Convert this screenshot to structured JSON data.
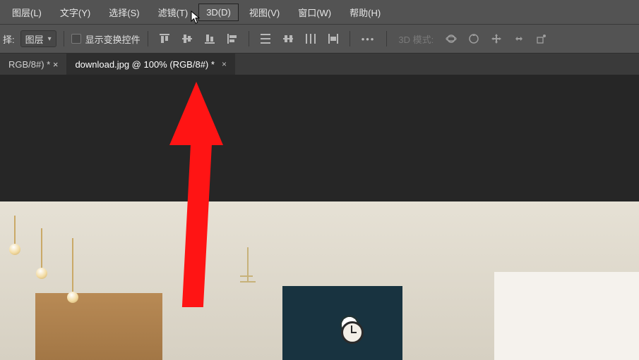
{
  "menubar": {
    "items": [
      {
        "label": "图层(L)"
      },
      {
        "label": "文字(Y)"
      },
      {
        "label": "选择(S)"
      },
      {
        "label": "滤镜(T)"
      },
      {
        "label": "3D(D)",
        "highlight": true
      },
      {
        "label": "视图(V)"
      },
      {
        "label": "窗口(W)"
      },
      {
        "label": "帮助(H)"
      }
    ]
  },
  "options": {
    "leading_label": "择:",
    "target_value": "图层",
    "show_transform_label": "显示变换控件",
    "mode_label": "3D 模式:"
  },
  "tabs": [
    {
      "label": "RGB/8#) * ×",
      "active": false
    },
    {
      "label": "download.jpg @ 100% (RGB/8#) *",
      "active": true
    }
  ],
  "annotation": {
    "arrow_color": "#ff1414"
  }
}
